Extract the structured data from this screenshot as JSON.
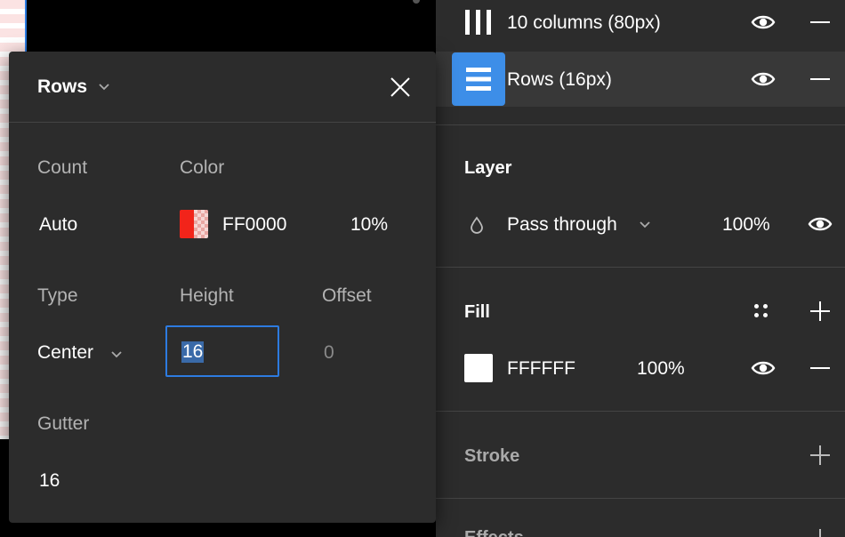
{
  "grids": [
    {
      "label": "10 columns (80px)",
      "icon": "columns-grid-icon",
      "selected": false
    },
    {
      "label": "Rows (16px)",
      "icon": "rows-grid-icon",
      "selected": true
    }
  ],
  "layer": {
    "title": "Layer",
    "blend_mode": "Pass through",
    "opacity": "100%"
  },
  "fill": {
    "title": "Fill",
    "color": "FFFFFF",
    "opacity": "100%",
    "swatch_color": "#ffffff"
  },
  "stroke": {
    "title": "Stroke"
  },
  "effects": {
    "title": "Effects"
  },
  "popover": {
    "title": "Rows",
    "count_label": "Count",
    "count_value": "Auto",
    "color_label": "Color",
    "color_hex": "FF0000",
    "color_opacity": "10%",
    "type_label": "Type",
    "type_value": "Center",
    "height_label": "Height",
    "height_value": "16",
    "offset_label": "Offset",
    "offset_value": "0",
    "gutter_label": "Gutter",
    "gutter_value": "16"
  },
  "colors": {
    "accent": "#2d7be0",
    "panel_bg": "#2c2c2c",
    "grid_color": "#f2241a"
  }
}
